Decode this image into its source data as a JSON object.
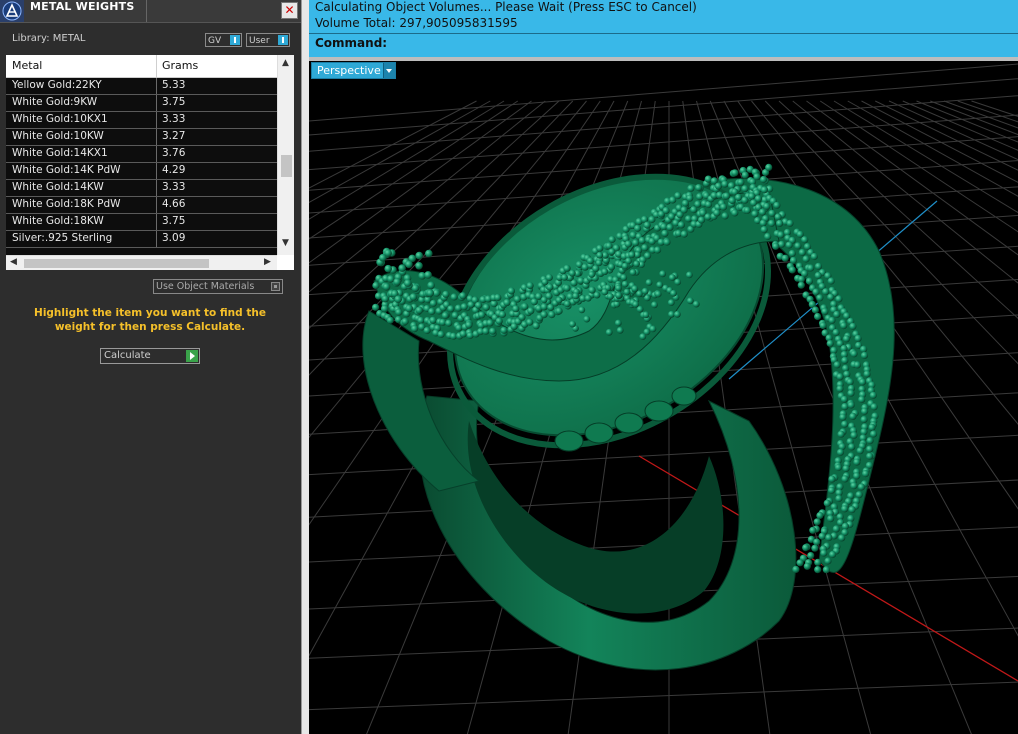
{
  "panel": {
    "title": "METAL WEIGHTS",
    "close_glyph": "✕",
    "library_label": "Library: METAL",
    "gv_label": "GV",
    "user_label": "User",
    "columns": [
      "Metal",
      "Grams"
    ],
    "rows": [
      {
        "metal": "Yellow Gold:22KY",
        "grams": "5.33"
      },
      {
        "metal": "White Gold:9KW",
        "grams": "3.75"
      },
      {
        "metal": "White Gold:10KX1",
        "grams": "3.33"
      },
      {
        "metal": "White Gold:10KW",
        "grams": "3.27"
      },
      {
        "metal": "White Gold:14KX1",
        "grams": "3.76"
      },
      {
        "metal": "White Gold:14K PdW",
        "grams": "4.29"
      },
      {
        "metal": "White Gold:14KW",
        "grams": "3.33"
      },
      {
        "metal": "White Gold:18K PdW",
        "grams": "4.66"
      },
      {
        "metal": "White Gold:18KW",
        "grams": "3.75"
      },
      {
        "metal": "Silver:.925 Sterling",
        "grams": "3.09"
      }
    ],
    "use_object_materials_label": "Use Object Materials",
    "hint": "Highlight the item you want to find the weight for then press Calculate.",
    "calculate_label": "Calculate"
  },
  "command": {
    "status_line_1": "Calculating Object Volumes... Please Wait (Press ESC to Cancel)",
    "status_line_2": "Volume Total: 297,905095831595",
    "label": "Command:",
    "input_value": ""
  },
  "viewport": {
    "label": "Perspective",
    "model_color": "#0f7a50",
    "background": "#000000",
    "grid_color": "#3a3a3a",
    "x_axis_color": "#c01818",
    "y_axis_color": "#1f8fc8"
  },
  "icons": {
    "app": "app-logo-icon",
    "close": "close-icon",
    "dropdown": "chevron-down-icon",
    "calculate": "play-icon"
  }
}
